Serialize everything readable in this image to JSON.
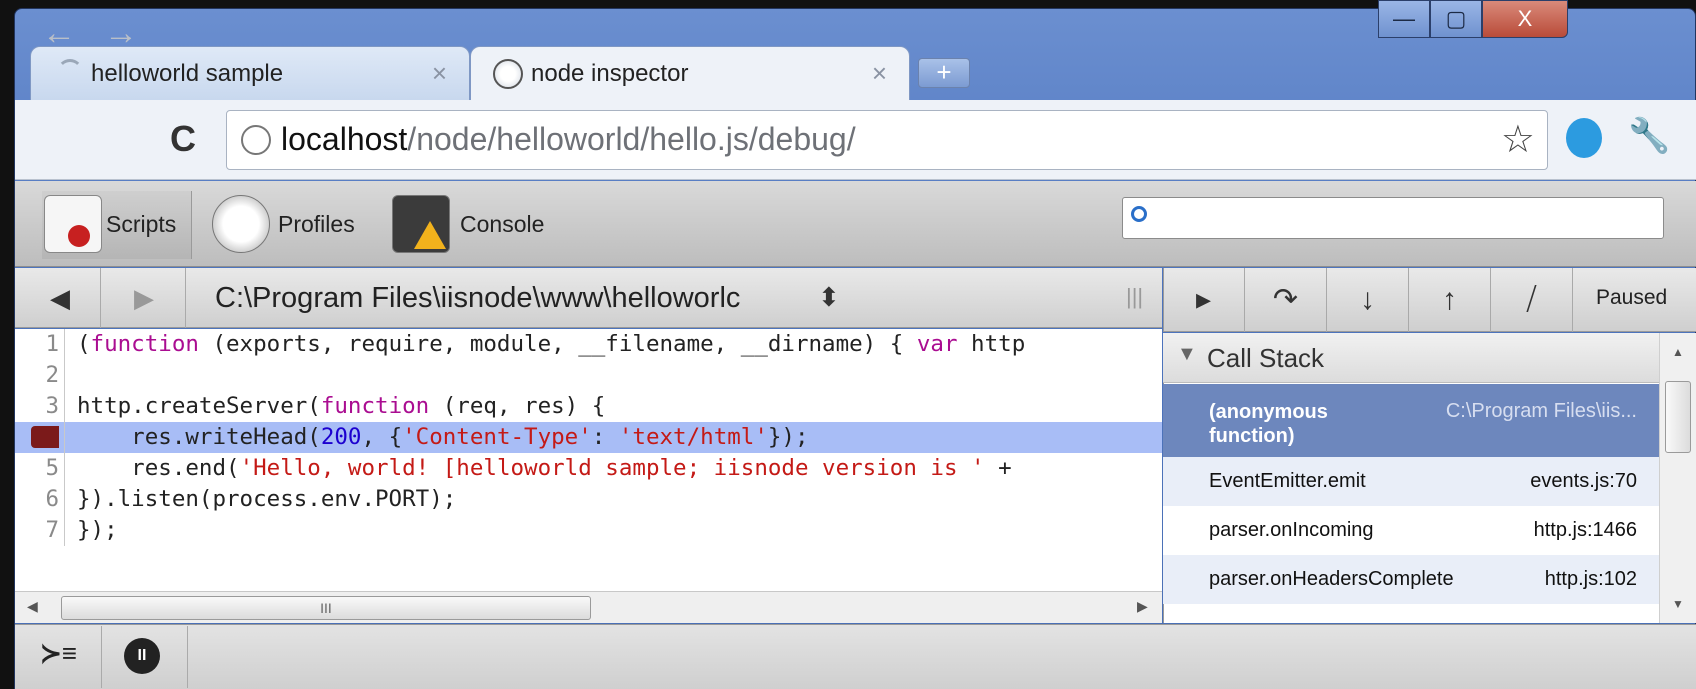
{
  "window": {
    "minimize_glyph": "—",
    "maximize_glyph": "▢",
    "close_glyph": "X"
  },
  "tabs": [
    {
      "label": "helloworld sample",
      "close": "×"
    },
    {
      "label": "node inspector",
      "close": "×"
    }
  ],
  "newtab_glyph": "+",
  "toolbar": {
    "back_glyph": "←",
    "forward_glyph": "→",
    "reload_glyph": "C",
    "url_host": "localhost",
    "url_path": "/node/helloworld/hello.js/debug/",
    "star_glyph": "☆",
    "wrench_glyph": "🔧"
  },
  "devtools": {
    "panels": [
      "Scripts",
      "Profiles",
      "Console"
    ],
    "search": {
      "placeholder": "",
      "icon": "search-icon"
    }
  },
  "source": {
    "file_path": "C:\\Program Files\\iisnode\\www\\helloworlc",
    "nav_back": "◀",
    "nav_forward": "▶",
    "select_arrows": "⬍",
    "grip": "|||",
    "line_numbers": [
      "1",
      "2",
      "3",
      "4",
      "5",
      "6",
      "7"
    ],
    "active_line": 4,
    "scroll_glyph": "III",
    "scroll_left": "◀",
    "scroll_right": "▶"
  },
  "debugger": {
    "buttons": [
      "resume",
      "step-over",
      "step-into",
      "step-out",
      "deactivate-breakpoints"
    ],
    "status": "Paused",
    "call_stack_title": "Call Stack",
    "call_stack": [
      {
        "function": "(anonymous function)",
        "location": "C:\\Program Files\\iis..."
      },
      {
        "function": "EventEmitter.emit",
        "location": "events.js:70"
      },
      {
        "function": "parser.onIncoming",
        "location": "http.js:1466"
      },
      {
        "function": "parser.onHeadersComplete",
        "location": "http.js:102"
      }
    ]
  },
  "statusbar": {
    "console_glyph": "≻≡",
    "pause_glyph": "II"
  },
  "colors": {
    "frame": "#4d74bd",
    "highlight": "#a8bdf6",
    "selected_frame": "#6d87bd",
    "keyword": "#aa0d91",
    "string": "#c41a16",
    "number": "#1c00cf"
  }
}
